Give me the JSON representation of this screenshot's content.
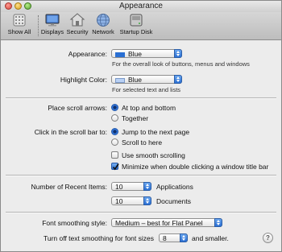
{
  "window": {
    "title": "Appearance"
  },
  "toolbar": {
    "items": [
      {
        "label": "Show All",
        "icon": "grid-icon"
      },
      {
        "label": "Displays",
        "icon": "display-icon"
      },
      {
        "label": "Security",
        "icon": "house-icon"
      },
      {
        "label": "Network",
        "icon": "globe-icon"
      },
      {
        "label": "Startup Disk",
        "icon": "disk-icon"
      }
    ]
  },
  "appearance": {
    "label": "Appearance:",
    "value": "Blue",
    "help": "For the overall look of buttons, menus and windows",
    "swatch_color": "#2a6fd3"
  },
  "highlight": {
    "label": "Highlight Color:",
    "value": "Blue",
    "help": "For selected text and lists",
    "swatch_color": "#b9d1f5"
  },
  "scroll_arrows": {
    "label": "Place scroll arrows:",
    "options": [
      {
        "label": "At top and bottom",
        "selected": true
      },
      {
        "label": "Together",
        "selected": false
      }
    ]
  },
  "scroll_bar": {
    "label": "Click in the scroll bar to:",
    "options": [
      {
        "label": "Jump to the next page",
        "selected": true
      },
      {
        "label": "Scroll to here",
        "selected": false
      }
    ],
    "smooth_scrolling": {
      "label": "Use smooth scrolling",
      "checked": false
    },
    "minimize_double_click": {
      "label": "Minimize when double clicking a window title bar",
      "checked": true
    }
  },
  "recent_items": {
    "label": "Number of Recent Items:",
    "applications": {
      "value": "10",
      "label": "Applications"
    },
    "documents": {
      "value": "10",
      "label": "Documents"
    }
  },
  "font_smoothing": {
    "label": "Font smoothing style:",
    "value": "Medium – best for Flat Panel"
  },
  "text_smoothing": {
    "label": "Turn off text smoothing for font sizes",
    "value": "8",
    "suffix": "and smaller."
  },
  "help_button": {
    "label": "?"
  },
  "colors": {
    "accent": "#2a6fd3"
  }
}
